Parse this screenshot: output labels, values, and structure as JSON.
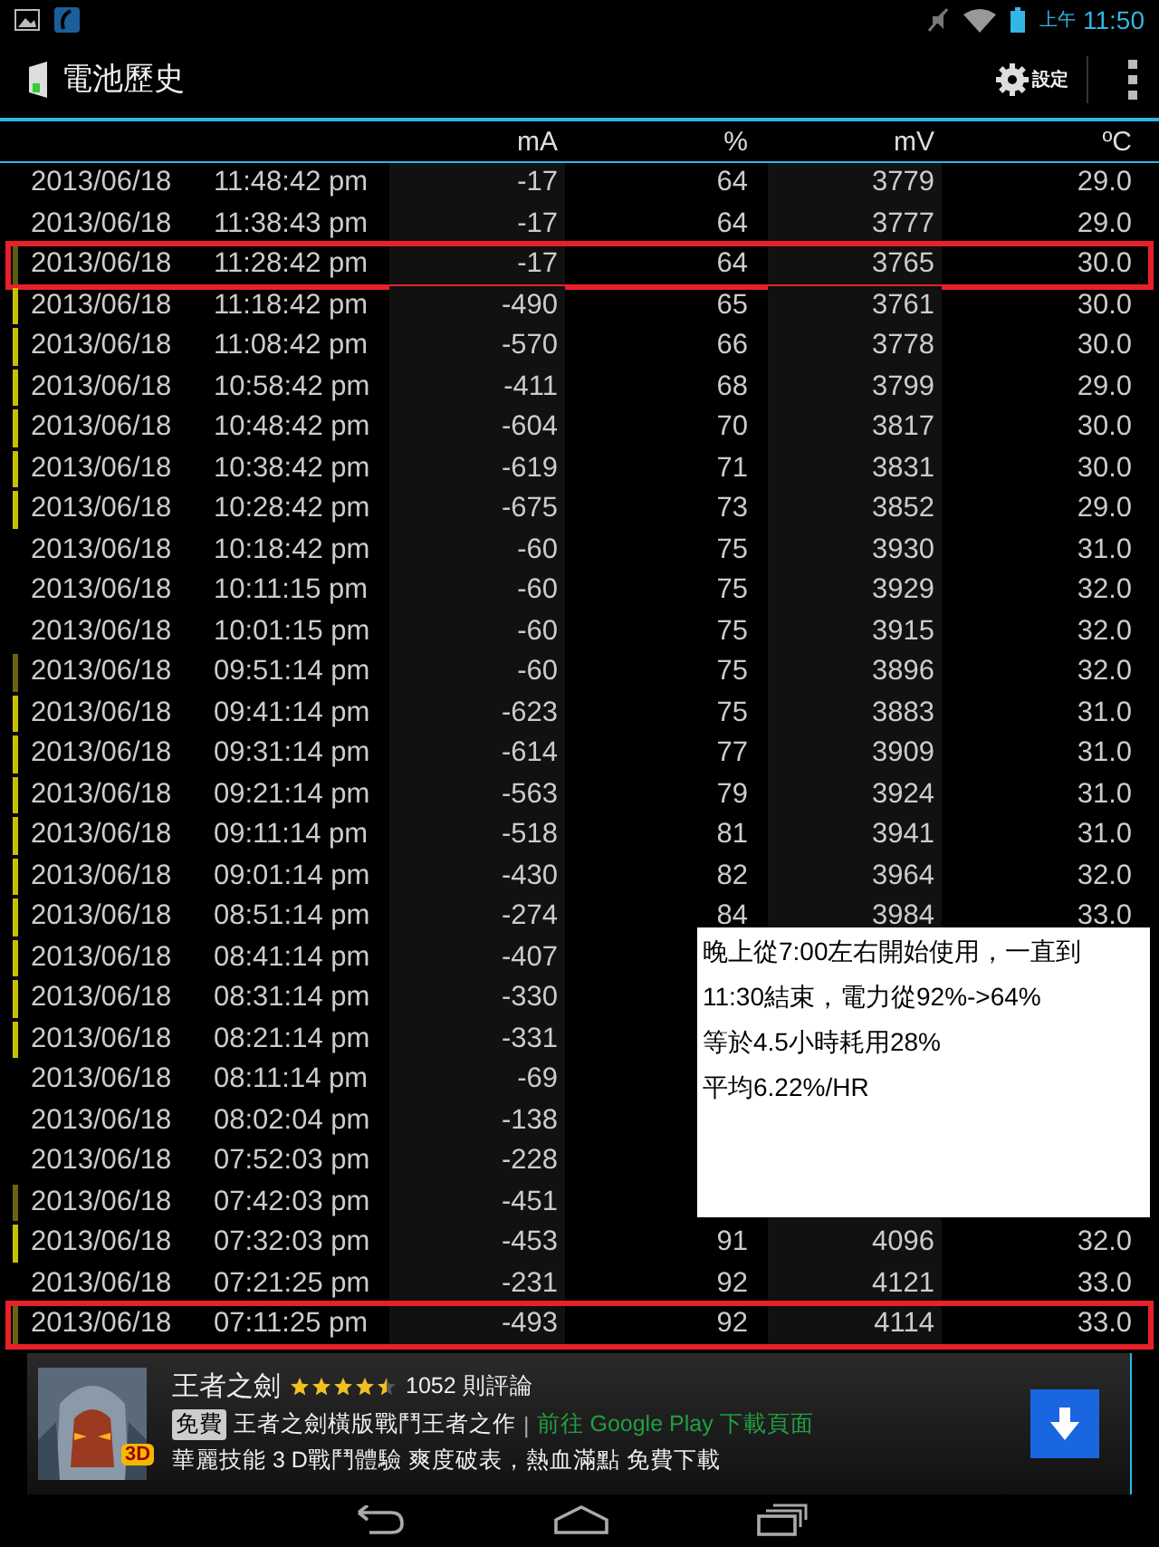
{
  "status_bar": {
    "ampm": "上午",
    "time": "11:50"
  },
  "action_bar": {
    "title": "電池歷史",
    "settings": "設定"
  },
  "table": {
    "columns": [
      "mA",
      "%",
      "mV",
      "ºC"
    ],
    "rows": [
      {
        "date": "2013/06/18",
        "time": "11:48:42 pm",
        "ma": "-17",
        "pct": "64",
        "mv": "3779",
        "temp": "29.0",
        "highlighted": false
      },
      {
        "date": "2013/06/18",
        "time": "11:38:43 pm",
        "ma": "-17",
        "pct": "64",
        "mv": "3777",
        "temp": "29.0",
        "highlighted": false
      },
      {
        "date": "2013/06/18",
        "time": "11:28:42 pm",
        "ma": "-17",
        "pct": "64",
        "mv": "3765",
        "temp": "30.0",
        "color": "#5c5c12",
        "highlighted": true
      },
      {
        "date": "2013/06/18",
        "time": "11:18:42 pm",
        "ma": "-490",
        "pct": "65",
        "mv": "3761",
        "temp": "30.0",
        "color": "#c8c000",
        "highlighted": false
      },
      {
        "date": "2013/06/18",
        "time": "11:08:42 pm",
        "ma": "-570",
        "pct": "66",
        "mv": "3778",
        "temp": "30.0",
        "color": "#c8c000",
        "highlighted": false
      },
      {
        "date": "2013/06/18",
        "time": "10:58:42 pm",
        "ma": "-411",
        "pct": "68",
        "mv": "3799",
        "temp": "29.0",
        "color": "#c8c000",
        "highlighted": false
      },
      {
        "date": "2013/06/18",
        "time": "10:48:42 pm",
        "ma": "-604",
        "pct": "70",
        "mv": "3817",
        "temp": "30.0",
        "color": "#c8c000",
        "highlighted": false
      },
      {
        "date": "2013/06/18",
        "time": "10:38:42 pm",
        "ma": "-619",
        "pct": "71",
        "mv": "3831",
        "temp": "30.0",
        "color": "#c8c000",
        "highlighted": false
      },
      {
        "date": "2013/06/18",
        "time": "10:28:42 pm",
        "ma": "-675",
        "pct": "73",
        "mv": "3852",
        "temp": "29.0",
        "color": "#c8c000",
        "highlighted": false
      },
      {
        "date": "2013/06/18",
        "time": "10:18:42 pm",
        "ma": "-60",
        "pct": "75",
        "mv": "3930",
        "temp": "31.0",
        "highlighted": false
      },
      {
        "date": "2013/06/18",
        "time": "10:11:15 pm",
        "ma": "-60",
        "pct": "75",
        "mv": "3929",
        "temp": "32.0",
        "highlighted": false
      },
      {
        "date": "2013/06/18",
        "time": "10:01:15 pm",
        "ma": "-60",
        "pct": "75",
        "mv": "3915",
        "temp": "32.0",
        "highlighted": false
      },
      {
        "date": "2013/06/18",
        "time": "09:51:14 pm",
        "ma": "-60",
        "pct": "75",
        "mv": "3896",
        "temp": "32.0",
        "color": "#6a6410",
        "highlighted": false
      },
      {
        "date": "2013/06/18",
        "time": "09:41:14 pm",
        "ma": "-623",
        "pct": "75",
        "mv": "3883",
        "temp": "31.0",
        "color": "#c8c000",
        "highlighted": false
      },
      {
        "date": "2013/06/18",
        "time": "09:31:14 pm",
        "ma": "-614",
        "pct": "77",
        "mv": "3909",
        "temp": "31.0",
        "color": "#c8c000",
        "highlighted": false
      },
      {
        "date": "2013/06/18",
        "time": "09:21:14 pm",
        "ma": "-563",
        "pct": "79",
        "mv": "3924",
        "temp": "31.0",
        "color": "#c8c000",
        "highlighted": false
      },
      {
        "date": "2013/06/18",
        "time": "09:11:14 pm",
        "ma": "-518",
        "pct": "81",
        "mv": "3941",
        "temp": "31.0",
        "color": "#c8c000",
        "highlighted": false
      },
      {
        "date": "2013/06/18",
        "time": "09:01:14 pm",
        "ma": "-430",
        "pct": "82",
        "mv": "3964",
        "temp": "32.0",
        "color": "#c8c000",
        "highlighted": false
      },
      {
        "date": "2013/06/18",
        "time": "08:51:14 pm",
        "ma": "-274",
        "pct": "84",
        "mv": "3984",
        "temp": "33.0",
        "color": "#c8c000",
        "highlighted": false
      },
      {
        "date": "2013/06/18",
        "time": "08:41:14 pm",
        "ma": "-407",
        "color": "#c8c000",
        "highlighted": false
      },
      {
        "date": "2013/06/18",
        "time": "08:31:14 pm",
        "ma": "-330",
        "color": "#c8c000",
        "highlighted": false
      },
      {
        "date": "2013/06/18",
        "time": "08:21:14 pm",
        "ma": "-331",
        "color": "#c8c000",
        "highlighted": false
      },
      {
        "date": "2013/06/18",
        "time": "08:11:14 pm",
        "ma": "-69",
        "highlighted": false
      },
      {
        "date": "2013/06/18",
        "time": "08:02:04 pm",
        "ma": "-138",
        "highlighted": false
      },
      {
        "date": "2013/06/18",
        "time": "07:52:03 pm",
        "ma": "-228",
        "highlighted": false
      },
      {
        "date": "2013/06/18",
        "time": "07:42:03 pm",
        "ma": "-451",
        "color": "#6a6410",
        "highlighted": false
      },
      {
        "date": "2013/06/18",
        "time": "07:32:03 pm",
        "ma": "-453",
        "pct": "91",
        "mv": "4096",
        "temp": "32.0",
        "color": "#c8c000",
        "highlighted": false
      },
      {
        "date": "2013/06/18",
        "time": "07:21:25 pm",
        "ma": "-231",
        "pct": "92",
        "mv": "4121",
        "temp": "33.0",
        "highlighted": false
      },
      {
        "date": "2013/06/18",
        "time": "07:11:25 pm",
        "ma": "-493",
        "pct": "92",
        "mv": "4114",
        "temp": "33.0",
        "color": "#6a6410",
        "highlighted": true
      }
    ]
  },
  "note": {
    "lines": [
      "晚上從7:00左右開始使用，一直到",
      "11:30結束，電力從92%->64%",
      "等於4.5小時耗用28%",
      "平均6.22%/HR"
    ]
  },
  "ad": {
    "title": "王者之劍",
    "stars": 4.5,
    "reviews": "1052 則評論",
    "tag": "免費",
    "description": "王者之劍橫版戰鬥王者之作",
    "separator": "|",
    "link": "前往 Google Play 下載頁面",
    "tagline": "華麗技能 3 D戰鬥體驗 爽度破表，熱血滿點 免費下載",
    "badge": "3D"
  }
}
